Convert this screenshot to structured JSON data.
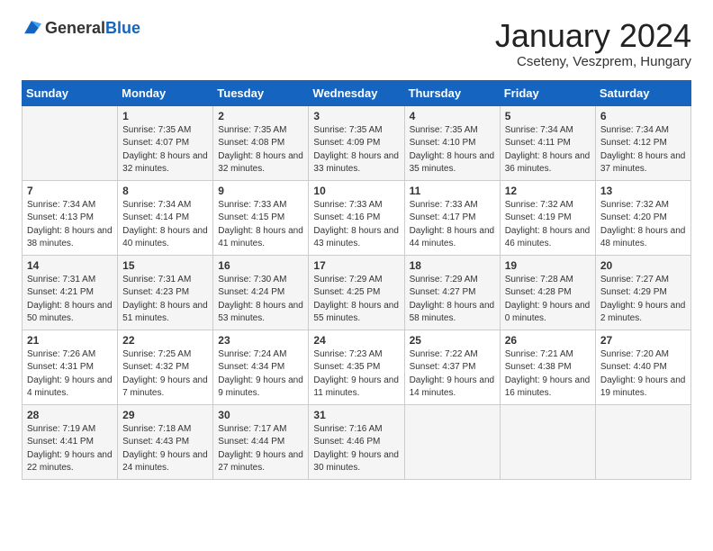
{
  "logo": {
    "general": "General",
    "blue": "Blue"
  },
  "title": "January 2024",
  "subtitle": "Cseteny, Veszprem, Hungary",
  "days_of_week": [
    "Sunday",
    "Monday",
    "Tuesday",
    "Wednesday",
    "Thursday",
    "Friday",
    "Saturday"
  ],
  "weeks": [
    [
      {
        "day": "",
        "sunrise": "",
        "sunset": "",
        "daylight": ""
      },
      {
        "day": "1",
        "sunrise": "Sunrise: 7:35 AM",
        "sunset": "Sunset: 4:07 PM",
        "daylight": "Daylight: 8 hours and 32 minutes."
      },
      {
        "day": "2",
        "sunrise": "Sunrise: 7:35 AM",
        "sunset": "Sunset: 4:08 PM",
        "daylight": "Daylight: 8 hours and 32 minutes."
      },
      {
        "day": "3",
        "sunrise": "Sunrise: 7:35 AM",
        "sunset": "Sunset: 4:09 PM",
        "daylight": "Daylight: 8 hours and 33 minutes."
      },
      {
        "day": "4",
        "sunrise": "Sunrise: 7:35 AM",
        "sunset": "Sunset: 4:10 PM",
        "daylight": "Daylight: 8 hours and 35 minutes."
      },
      {
        "day": "5",
        "sunrise": "Sunrise: 7:34 AM",
        "sunset": "Sunset: 4:11 PM",
        "daylight": "Daylight: 8 hours and 36 minutes."
      },
      {
        "day": "6",
        "sunrise": "Sunrise: 7:34 AM",
        "sunset": "Sunset: 4:12 PM",
        "daylight": "Daylight: 8 hours and 37 minutes."
      }
    ],
    [
      {
        "day": "7",
        "sunrise": "Sunrise: 7:34 AM",
        "sunset": "Sunset: 4:13 PM",
        "daylight": "Daylight: 8 hours and 38 minutes."
      },
      {
        "day": "8",
        "sunrise": "Sunrise: 7:34 AM",
        "sunset": "Sunset: 4:14 PM",
        "daylight": "Daylight: 8 hours and 40 minutes."
      },
      {
        "day": "9",
        "sunrise": "Sunrise: 7:33 AM",
        "sunset": "Sunset: 4:15 PM",
        "daylight": "Daylight: 8 hours and 41 minutes."
      },
      {
        "day": "10",
        "sunrise": "Sunrise: 7:33 AM",
        "sunset": "Sunset: 4:16 PM",
        "daylight": "Daylight: 8 hours and 43 minutes."
      },
      {
        "day": "11",
        "sunrise": "Sunrise: 7:33 AM",
        "sunset": "Sunset: 4:17 PM",
        "daylight": "Daylight: 8 hours and 44 minutes."
      },
      {
        "day": "12",
        "sunrise": "Sunrise: 7:32 AM",
        "sunset": "Sunset: 4:19 PM",
        "daylight": "Daylight: 8 hours and 46 minutes."
      },
      {
        "day": "13",
        "sunrise": "Sunrise: 7:32 AM",
        "sunset": "Sunset: 4:20 PM",
        "daylight": "Daylight: 8 hours and 48 minutes."
      }
    ],
    [
      {
        "day": "14",
        "sunrise": "Sunrise: 7:31 AM",
        "sunset": "Sunset: 4:21 PM",
        "daylight": "Daylight: 8 hours and 50 minutes."
      },
      {
        "day": "15",
        "sunrise": "Sunrise: 7:31 AM",
        "sunset": "Sunset: 4:23 PM",
        "daylight": "Daylight: 8 hours and 51 minutes."
      },
      {
        "day": "16",
        "sunrise": "Sunrise: 7:30 AM",
        "sunset": "Sunset: 4:24 PM",
        "daylight": "Daylight: 8 hours and 53 minutes."
      },
      {
        "day": "17",
        "sunrise": "Sunrise: 7:29 AM",
        "sunset": "Sunset: 4:25 PM",
        "daylight": "Daylight: 8 hours and 55 minutes."
      },
      {
        "day": "18",
        "sunrise": "Sunrise: 7:29 AM",
        "sunset": "Sunset: 4:27 PM",
        "daylight": "Daylight: 8 hours and 58 minutes."
      },
      {
        "day": "19",
        "sunrise": "Sunrise: 7:28 AM",
        "sunset": "Sunset: 4:28 PM",
        "daylight": "Daylight: 9 hours and 0 minutes."
      },
      {
        "day": "20",
        "sunrise": "Sunrise: 7:27 AM",
        "sunset": "Sunset: 4:29 PM",
        "daylight": "Daylight: 9 hours and 2 minutes."
      }
    ],
    [
      {
        "day": "21",
        "sunrise": "Sunrise: 7:26 AM",
        "sunset": "Sunset: 4:31 PM",
        "daylight": "Daylight: 9 hours and 4 minutes."
      },
      {
        "day": "22",
        "sunrise": "Sunrise: 7:25 AM",
        "sunset": "Sunset: 4:32 PM",
        "daylight": "Daylight: 9 hours and 7 minutes."
      },
      {
        "day": "23",
        "sunrise": "Sunrise: 7:24 AM",
        "sunset": "Sunset: 4:34 PM",
        "daylight": "Daylight: 9 hours and 9 minutes."
      },
      {
        "day": "24",
        "sunrise": "Sunrise: 7:23 AM",
        "sunset": "Sunset: 4:35 PM",
        "daylight": "Daylight: 9 hours and 11 minutes."
      },
      {
        "day": "25",
        "sunrise": "Sunrise: 7:22 AM",
        "sunset": "Sunset: 4:37 PM",
        "daylight": "Daylight: 9 hours and 14 minutes."
      },
      {
        "day": "26",
        "sunrise": "Sunrise: 7:21 AM",
        "sunset": "Sunset: 4:38 PM",
        "daylight": "Daylight: 9 hours and 16 minutes."
      },
      {
        "day": "27",
        "sunrise": "Sunrise: 7:20 AM",
        "sunset": "Sunset: 4:40 PM",
        "daylight": "Daylight: 9 hours and 19 minutes."
      }
    ],
    [
      {
        "day": "28",
        "sunrise": "Sunrise: 7:19 AM",
        "sunset": "Sunset: 4:41 PM",
        "daylight": "Daylight: 9 hours and 22 minutes."
      },
      {
        "day": "29",
        "sunrise": "Sunrise: 7:18 AM",
        "sunset": "Sunset: 4:43 PM",
        "daylight": "Daylight: 9 hours and 24 minutes."
      },
      {
        "day": "30",
        "sunrise": "Sunrise: 7:17 AM",
        "sunset": "Sunset: 4:44 PM",
        "daylight": "Daylight: 9 hours and 27 minutes."
      },
      {
        "day": "31",
        "sunrise": "Sunrise: 7:16 AM",
        "sunset": "Sunset: 4:46 PM",
        "daylight": "Daylight: 9 hours and 30 minutes."
      },
      {
        "day": "",
        "sunrise": "",
        "sunset": "",
        "daylight": ""
      },
      {
        "day": "",
        "sunrise": "",
        "sunset": "",
        "daylight": ""
      },
      {
        "day": "",
        "sunrise": "",
        "sunset": "",
        "daylight": ""
      }
    ]
  ]
}
